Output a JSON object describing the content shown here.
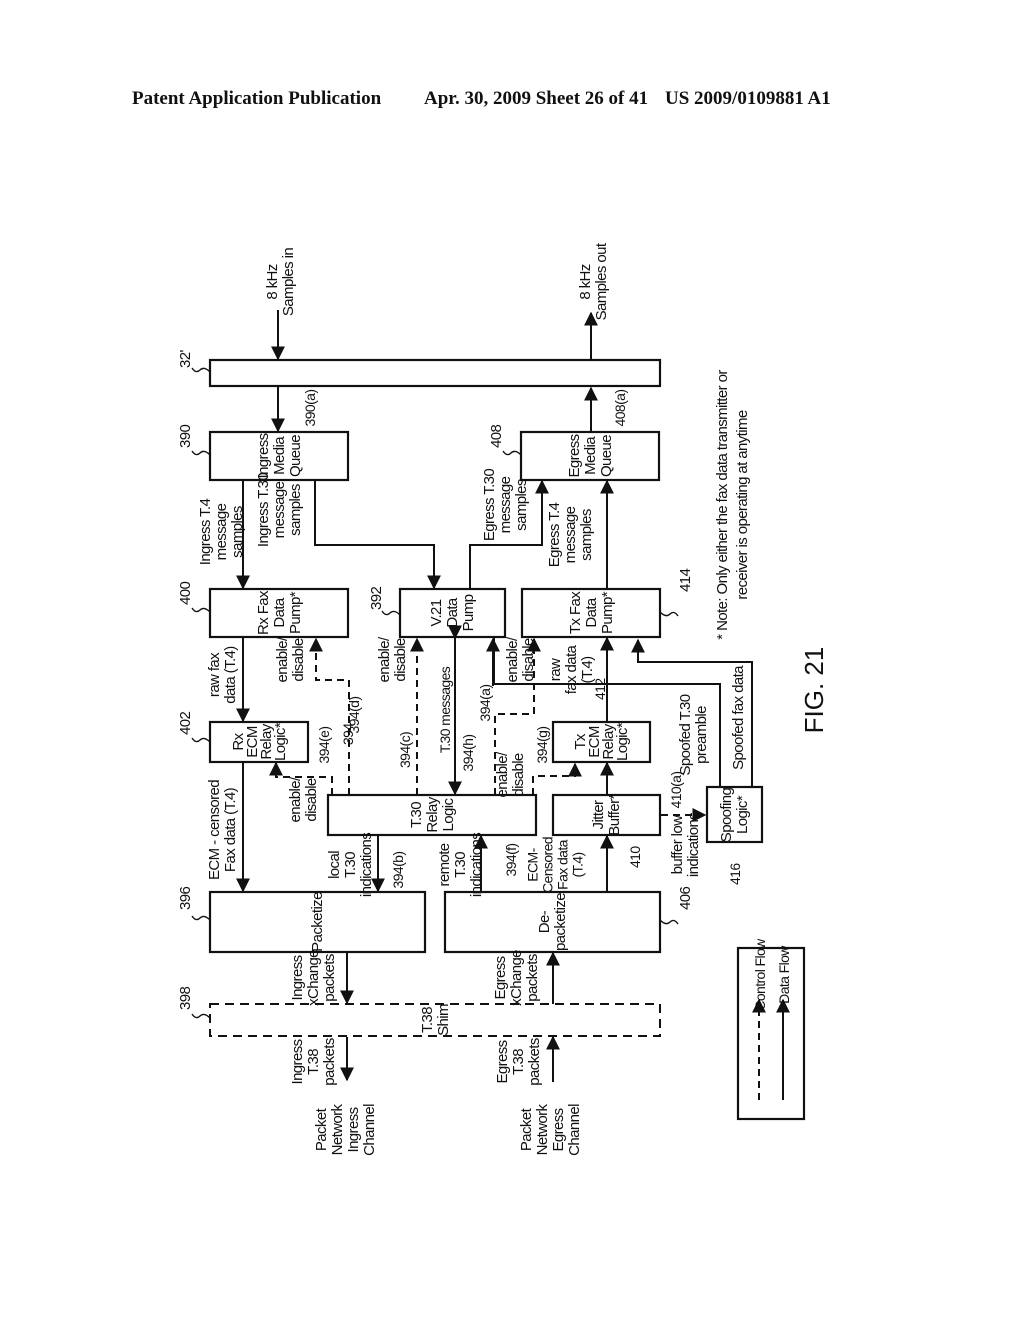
{
  "header": {
    "left": "Patent Application Publication",
    "middle": "Apr. 30, 2009  Sheet 26 of 41",
    "right": "US 2009/0109881 A1"
  },
  "figure_label": "FIG. 21",
  "note": [
    "* Note: Only either the fax data transmitter or",
    "receiver is operating at anytime"
  ],
  "legend": {
    "control": "Control Flow",
    "data": "Data Flow"
  },
  "blocks": {
    "b32": {
      "ref": "32'",
      "label": []
    },
    "ingress_queue": {
      "ref": "390",
      "label": [
        "Ingress",
        "Media",
        "Queue"
      ]
    },
    "egress_queue": {
      "ref": "408",
      "label": [
        "Egress",
        "Media",
        "Queue"
      ]
    },
    "rx_pump": {
      "ref": "400",
      "label": [
        "Rx Fax",
        "Data",
        "Pump*"
      ]
    },
    "v21_pump": {
      "ref": "392",
      "label": [
        "V.21",
        "Data",
        "Pump"
      ]
    },
    "tx_pump": {
      "ref": "414",
      "label": [
        "Tx Fax",
        "Data",
        "Pump*"
      ]
    },
    "rx_ecm": {
      "ref": "402",
      "label": [
        "Rx",
        "ECM",
        "Relay",
        "Logic*"
      ]
    },
    "t30_relay": {
      "ref": "394",
      "label": [
        "T.30",
        "Relay",
        "Logic"
      ]
    },
    "tx_ecm": {
      "ref": "412",
      "label": [
        "Tx",
        "ECM",
        "Relay",
        "Logic*"
      ]
    },
    "jitter": {
      "ref": "410",
      "label": [
        "Jitter",
        "Buffer*"
      ]
    },
    "spoofing": {
      "ref": "416",
      "label": [
        "Spoofing",
        "Logic*"
      ]
    },
    "packetize": {
      "ref": "396",
      "label": [
        "Packetize"
      ]
    },
    "depacketize": {
      "ref": "406",
      "label": [
        "De-",
        "packetize"
      ]
    },
    "shim": {
      "ref": "398",
      "label": [
        "T.38",
        "Shim"
      ]
    }
  },
  "signals": {
    "samples_in": [
      "8 kHz",
      "Samples in"
    ],
    "samples_out": [
      "8 kHz",
      "Samples out"
    ],
    "r390a": "390(a)",
    "r408a": "408(a)",
    "ingress_t4": [
      "Ingress T.4",
      "message",
      "samples"
    ],
    "ingress_t30": [
      "Ingress T.30",
      "message",
      "samples"
    ],
    "egress_t30": [
      "Egress T.30",
      "message",
      "samples"
    ],
    "egress_t4": [
      "Egress T.4",
      "message",
      "samples"
    ],
    "raw_fax_rx": [
      "raw fax",
      "data (T.4)"
    ],
    "enable_disable": [
      "enable/",
      "disable"
    ],
    "raw_fax_tx": [
      "raw",
      "fax data",
      "(T.4)"
    ],
    "t30_messages": "T.30 messages",
    "r394a": "394(a)",
    "r394b": "394(b)",
    "r394c": "394(c)",
    "r394d": "394(d)",
    "r394e": "394(e)",
    "r394f": "394(f)",
    "r394g": "394(g)",
    "r394h": "394(h)",
    "r410a": "410(a)",
    "ecm_censored": [
      "ECM - censored",
      "Fax data (T.4)"
    ],
    "local_t30": [
      "local",
      "T.30",
      "indications"
    ],
    "remote_t30": [
      "remote",
      "T.30",
      "indications"
    ],
    "ecm_censored2": [
      "ECM-",
      "Censored",
      "Fax data",
      "(T.4)"
    ],
    "buffer_low": [
      "buffer low",
      "indications"
    ],
    "spoofed_preamble": [
      "Spoofed T.30",
      "preamble"
    ],
    "spoofed_fax": "Spoofed fax data",
    "ingress_xchange": [
      "Ingress",
      "xChange",
      "packets"
    ],
    "egress_xchange": [
      "Egress",
      "xChange",
      "packets"
    ],
    "ingress_t38": [
      "Ingress",
      "T.38",
      "packets"
    ],
    "egress_t38": [
      "Egress",
      "T.38",
      "packets"
    ],
    "pn_ingress": [
      "Packet",
      "Network",
      "Ingress",
      "Channel"
    ],
    "pn_egress": [
      "Packet",
      "Network",
      "Egress",
      "Channel"
    ]
  }
}
